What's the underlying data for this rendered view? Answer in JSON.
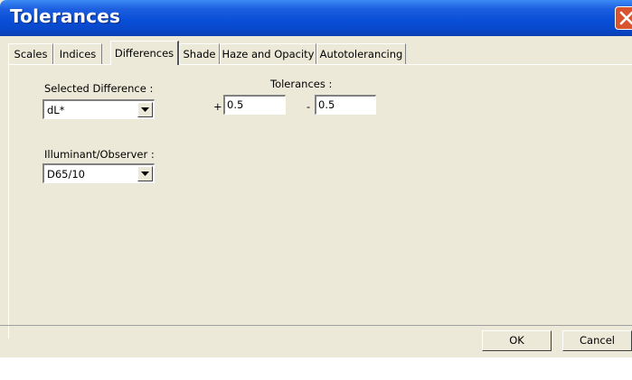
{
  "window": {
    "title": "Tolerances"
  },
  "tabs": [
    {
      "label": "Scales"
    },
    {
      "label": "Indices"
    },
    {
      "label": "Differences",
      "active": true
    },
    {
      "label": "Shade"
    },
    {
      "label": "Haze and Opacity"
    },
    {
      "label": "Autotolerancing"
    }
  ],
  "differences": {
    "selected_difference_label": "Selected Difference :",
    "selected_difference_value": "dL*",
    "tolerances_label": "Tolerances :",
    "plus_sign": "+",
    "plus_value": "0.5",
    "minus_sign": "-",
    "minus_value": "0.5",
    "illuminant_label": "Illuminant/Observer :",
    "illuminant_value": "D65/10"
  },
  "buttons": {
    "ok": "OK",
    "cancel": "Cancel"
  },
  "colors": {
    "titlebar": "#0A4FD8",
    "face": "#ECE9D8",
    "close": "#D9542E"
  },
  "icons": {
    "close": "close-icon",
    "dropdown": "chevron-down-icon"
  }
}
